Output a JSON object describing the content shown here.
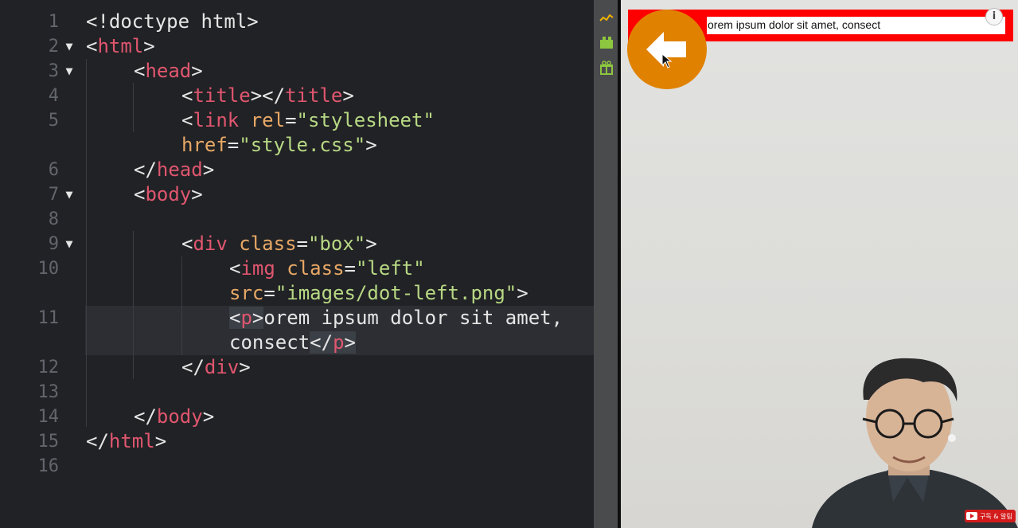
{
  "editor": {
    "line_numbers": [
      "1",
      "2",
      "3",
      "4",
      "5",
      "6",
      "7",
      "8",
      "9",
      "10",
      "11",
      "12",
      "13",
      "14",
      "15",
      "16"
    ],
    "fold_marker": "▼",
    "code": {
      "l1": {
        "a": "<!doctype html>"
      },
      "l2": {
        "open": "<",
        "tag": "html",
        "close": ">"
      },
      "l3": {
        "open": "<",
        "tag": "head",
        "close": ">"
      },
      "l4": {
        "open1": "<",
        "tag1": "title",
        "mid": "></",
        "tag2": "title",
        "close": ">"
      },
      "l5": {
        "open": "<",
        "tag": "link",
        "sp": " ",
        "attr": "rel",
        "eq": "=",
        "val": "\"stylesheet\""
      },
      "l5b": {
        "attr": "href",
        "eq": "=",
        "val": "\"style.css\"",
        "close": ">"
      },
      "l6": {
        "open": "</",
        "tag": "head",
        "close": ">"
      },
      "l7": {
        "open": "<",
        "tag": "body",
        "close": ">"
      },
      "l9": {
        "open": "<",
        "tag": "div",
        "sp": " ",
        "attr": "class",
        "eq": "=",
        "val": "\"box\"",
        "close": ">"
      },
      "l10": {
        "open": "<",
        "tag": "img",
        "sp": " ",
        "attr": "class",
        "eq": "=",
        "val": "\"left\""
      },
      "l10b": {
        "attr": "src",
        "eq": "=",
        "val": "\"images/dot-left.png\"",
        "close": ">"
      },
      "l11": {
        "open": "<",
        "tag": "p",
        "close": ">",
        "text": "orem ipsum dolor sit amet,"
      },
      "l11b": {
        "text": "consect",
        "open": "</",
        "tag": "p",
        "close": ">"
      },
      "l12": {
        "open": "</",
        "tag": "div",
        "close": ">"
      },
      "l14": {
        "open": "</",
        "tag": "body",
        "close": ">"
      },
      "l15": {
        "open": "</",
        "tag": "html",
        "close": ">"
      }
    }
  },
  "toolbar": {
    "icons": [
      "pulse-icon",
      "extension-icon",
      "gift-icon"
    ],
    "accent": "#8dc63f"
  },
  "preview": {
    "box_color": "#ff0000",
    "circle_color": "#e08200",
    "paragraph": "orem ipsum dolor sit amet, consect",
    "info_label": "i",
    "badge_text": "구독 & 알림"
  }
}
